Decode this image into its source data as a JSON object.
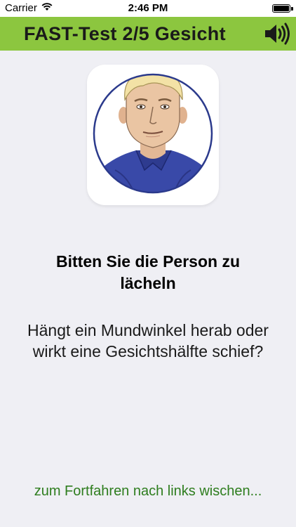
{
  "status_bar": {
    "carrier": "Carrier",
    "time": "2:46 PM"
  },
  "header": {
    "title": "FAST-Test 2/5 Gesicht",
    "background_color": "#8cc63f"
  },
  "icons": {
    "wifi": "wifi-icon",
    "battery": "battery-icon",
    "speaker": "speaker-icon"
  },
  "main": {
    "prompt": "Bitten Sie die Person zu lächeln",
    "question": "Hängt ein Mundwinkel herab oder wirkt eine Gesichtshälfte schief?"
  },
  "footer": {
    "hint": "zum Fortfahren nach links wischen...",
    "hint_color": "#2e7d1e"
  }
}
